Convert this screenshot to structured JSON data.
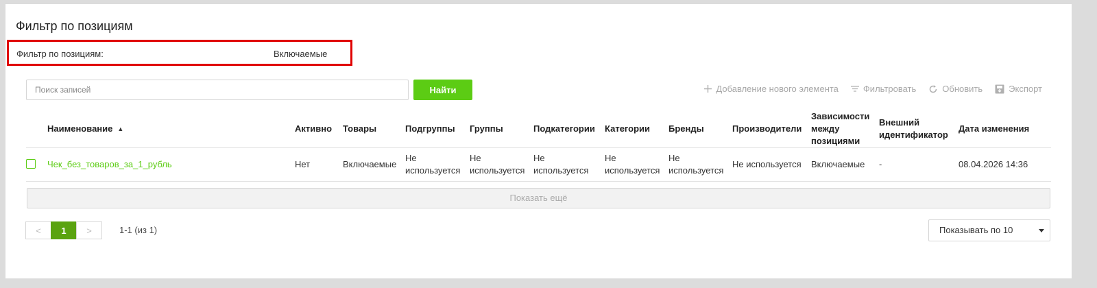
{
  "page": {
    "title": "Фильтр по позициям",
    "filter": {
      "label": "Фильтр по позициям:",
      "value": "Включаемые"
    }
  },
  "search": {
    "placeholder": "Поиск записей",
    "value": "",
    "button": "Найти"
  },
  "toolbar": {
    "add": {
      "label": "Добавление нового элемента",
      "icon": "plus-icon"
    },
    "filter": {
      "label": "Фильтровать",
      "icon": "filter-icon"
    },
    "refresh": {
      "label": "Обновить",
      "icon": "refresh-icon"
    },
    "export": {
      "label": "Экспорт",
      "icon": "export-icon"
    }
  },
  "table": {
    "columns": [
      "Наименование",
      "Активно",
      "Товары",
      "Подгруппы",
      "Группы",
      "Подкатегории",
      "Категории",
      "Бренды",
      "Производители",
      "Зависимости\nмежду\nпозициями",
      "Внешний\nидентификатор",
      "Дата изменения"
    ],
    "sorted_column": "Наименование",
    "sort_direction": "asc",
    "rows": [
      {
        "cells": [
          "Чек_без_товаров_за_1_рубль",
          "Нет",
          "Включаемые",
          "Не\nиспользуется",
          "Не\nиспользуется",
          "Не\nиспользуется",
          "Не\nиспользуется",
          "Не\nиспользуется",
          "Не используется",
          "Включаемые",
          "-",
          "08.04.2026 14:36"
        ],
        "checked": false
      }
    ]
  },
  "show_more": "Показать ещё",
  "pagination": {
    "prev": "<",
    "current": "1",
    "next": ">",
    "info": "1-1 (из 1)",
    "page_size_label": "Показывать по 10"
  },
  "colors": {
    "accent": "#5ccc14",
    "active_page": "#5aa310",
    "highlight_border": "#e00000"
  }
}
